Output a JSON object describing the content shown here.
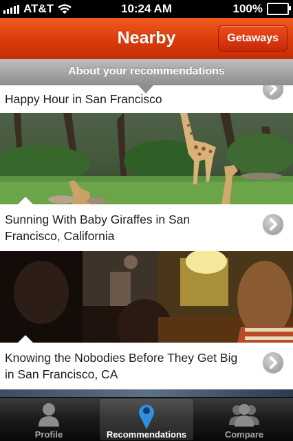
{
  "status_bar": {
    "carrier": "AT&T",
    "time": "10:24 AM",
    "battery": "100%"
  },
  "nav": {
    "title": "Nearby",
    "getaways_label": "Getaways"
  },
  "banner": {
    "text": "About your recommendations"
  },
  "cards": [
    {
      "title": "Happy Hour in San Francisco"
    },
    {
      "title": "Sunning With Baby Giraffes in San Francisco, California"
    },
    {
      "title": "Knowing the Nobodies Before They Get Big in San Francisco, CA"
    }
  ],
  "tabs": [
    {
      "label": "Profile",
      "icon": "person-icon"
    },
    {
      "label": "Recommendations",
      "icon": "map-pin-icon",
      "active": true
    },
    {
      "label": "Compare",
      "icon": "people-icon"
    }
  ],
  "colors": {
    "nav_orange": "#d8390a",
    "pin_blue": "#2f8fe0"
  }
}
